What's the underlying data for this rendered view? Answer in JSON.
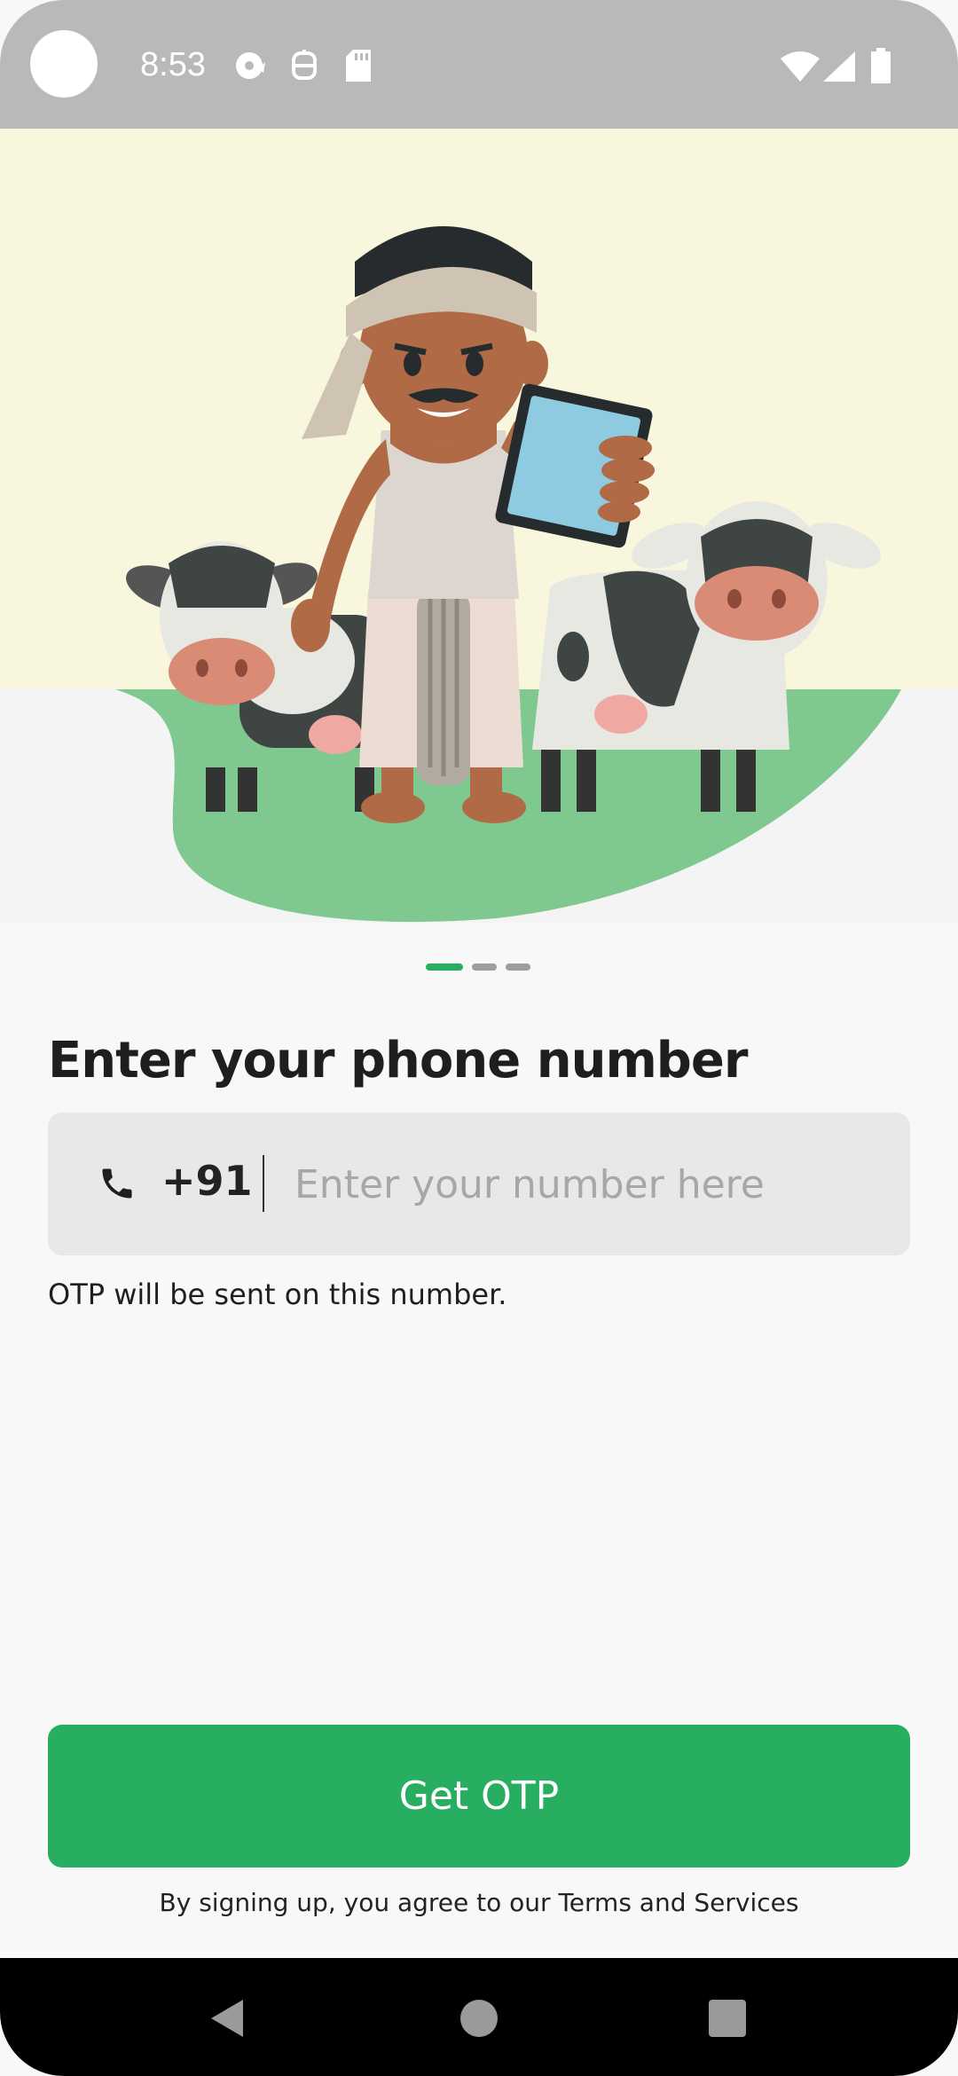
{
  "status_bar": {
    "time": "8:53",
    "icons": [
      "camera-cutout",
      "media-icon",
      "android-icon",
      "sd-card-icon",
      "wifi-icon",
      "signal-icon",
      "battery-icon"
    ]
  },
  "hero": {
    "illustration": "farmer-with-tablet-and-cows"
  },
  "pager": {
    "pages": 3,
    "active_index": 0,
    "active_color": "#27ae60",
    "inactive_color": "#9e9e9e"
  },
  "form": {
    "title": "Enter your phone number",
    "country_code": "+91",
    "phone_placeholder": "Enter your number here",
    "phone_value": "",
    "helper": "OTP will be sent on this number."
  },
  "actions": {
    "get_otp_label": "Get OTP",
    "terms_text": "By signing up, you agree to our Terms and Services"
  },
  "colors": {
    "accent": "#27ae60",
    "hero_bg": "#f8f6dc",
    "grass": "#7fc88f"
  },
  "nav_bar": {
    "buttons": [
      "back-icon",
      "home-icon",
      "recents-icon"
    ]
  }
}
